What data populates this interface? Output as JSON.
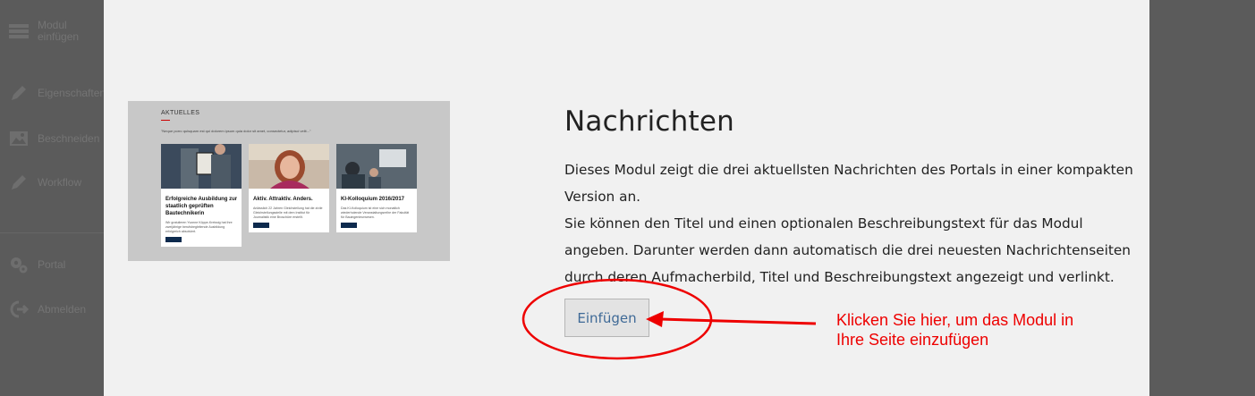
{
  "sidebar": {
    "items": [
      {
        "label": "Modul\neinfügen",
        "icon": "module-icon"
      },
      {
        "label": "Eigenschaften",
        "icon": "pencil-icon"
      },
      {
        "label": "Beschneiden",
        "icon": "image-icon"
      },
      {
        "label": "Workflow",
        "icon": "pencil-icon"
      },
      {
        "label": "Portal",
        "icon": "gears-icon"
      },
      {
        "label": "Abmelden",
        "icon": "logout-icon"
      }
    ]
  },
  "preview": {
    "section_title": "AKTUELLES",
    "intro": "\"Neque porro quisquam est qui dolorem ipsum quia dolor sit amet, consectetur, adipisci velit...\"",
    "cards": [
      {
        "title": "Erfolgreiche Ausbildung zur staatlich geprüften Bautechnikerin",
        "text": "Wir gratulieren Yvonne Köppe-Kreissig hat ihre zweijährige berufsbegleitende Ausbildung erfolgreich absolviert."
      },
      {
        "title": "Aktiv. Attraktiv. Anders.",
        "text": "Anlässlich 22 Jahren Gleichstellung hat die zivile Gleichstellungsstelle mit dem Institut für Journalistik eine Broschüre erstellt."
      },
      {
        "title": "KI-Kolloquium 2016/2017",
        "text": "Das KI-Kolloquium ist eine sich monatlich wiederholende Veranstaltungsreihe der Fakultät für Bauingenieurwesen."
      }
    ]
  },
  "module": {
    "title": "Nachrichten",
    "description_lines": [
      "Dieses Modul zeigt die drei aktuellsten Nachrichten des Portals in einer kompakten",
      "Version an.",
      "Sie können den Titel und einen optionalen Beschreibungstext für das Modul",
      "angeben. Darunter werden dann automatisch die drei neuesten Nachrichtenseiten",
      "durch deren Aufmacherbild, Titel und Beschreibungstext angezeigt und verlinkt."
    ],
    "insert_button": "Einfügen"
  },
  "annotation": {
    "line1": "Klicken Sie hier, um das Modul in",
    "line2": "Ihre Seite einzufügen",
    "color": "#ee0000"
  }
}
